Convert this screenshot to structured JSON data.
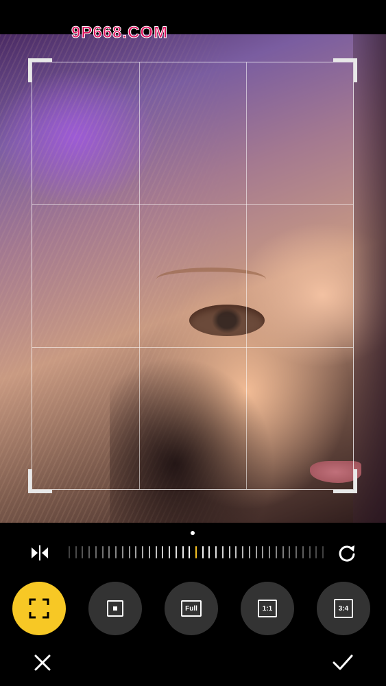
{
  "watermark": "9P668.COM",
  "crop": {
    "grid_rows": 3,
    "grid_cols": 3
  },
  "toolbar": {
    "straighten": {
      "ticks": 39,
      "active_index": 19
    },
    "icons": {
      "flip": "flip-horizontal-icon",
      "rotate": "rotate-icon",
      "cancel": "close-icon",
      "confirm": "checkmark-icon"
    },
    "ratios": [
      {
        "id": "free",
        "label": "",
        "icon": "free-crop-icon",
        "selected": true
      },
      {
        "id": "square-dot",
        "label": "",
        "icon": "square-dot-icon",
        "selected": false
      },
      {
        "id": "full",
        "label": "Full",
        "icon": "",
        "selected": false
      },
      {
        "id": "1-1",
        "label": "1:1",
        "icon": "",
        "selected": false
      },
      {
        "id": "3-4",
        "label": "3:4",
        "icon": "",
        "selected": false
      }
    ]
  },
  "colors": {
    "accent": "#f7c825",
    "button_bg": "#333333",
    "background": "#000000",
    "watermark": "#e0125f"
  }
}
